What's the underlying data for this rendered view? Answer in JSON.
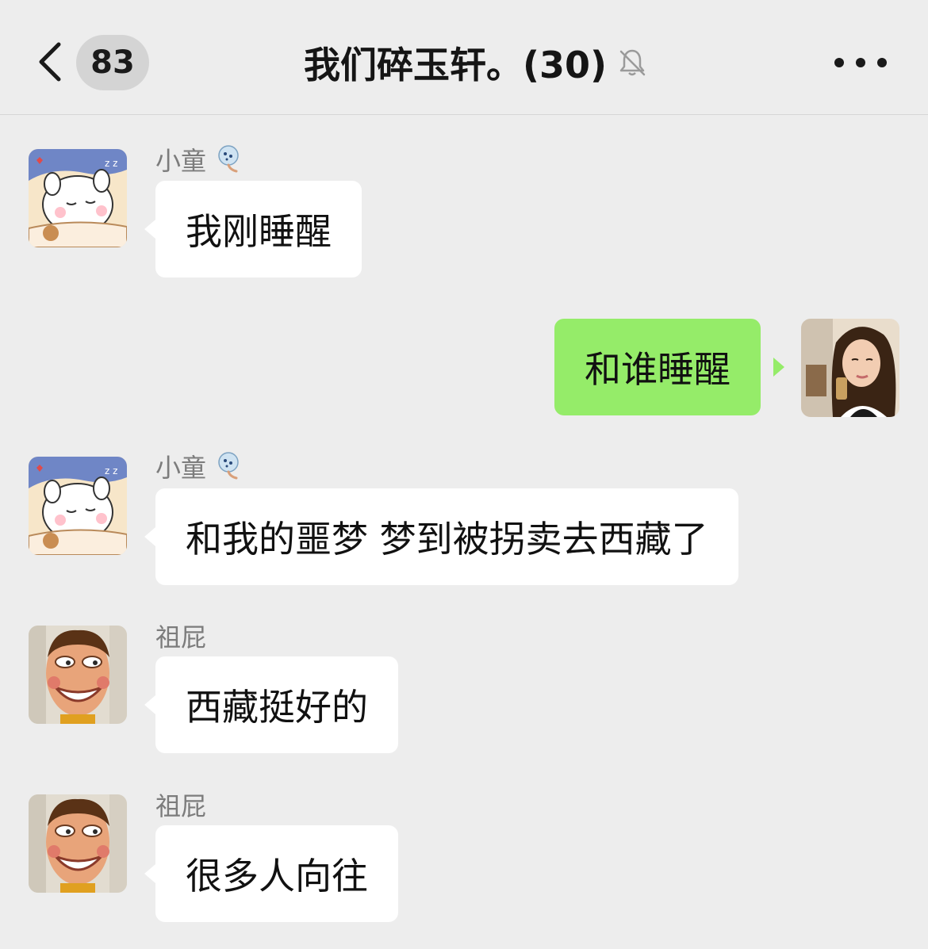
{
  "header": {
    "back_icon": "chevron-left-icon",
    "unread_count": "83",
    "title": "我们碎玉轩。(30)",
    "mute_icon": "bell-off-icon",
    "more_icon": "more-horizontal-icon"
  },
  "colors": {
    "background": "#ededed",
    "bubble_incoming": "#ffffff",
    "bubble_outgoing": "#95ec69",
    "badge": "#d4d4d4"
  },
  "messages": [
    {
      "sender": "小童",
      "badge_icon": "bear-emoji-icon",
      "direction": "incoming",
      "text": "我刚睡醒"
    },
    {
      "sender": "",
      "direction": "outgoing",
      "text": "和谁睡醒"
    },
    {
      "sender": "小童",
      "badge_icon": "bear-emoji-icon",
      "direction": "incoming",
      "text": "和我的噩梦 梦到被拐卖去西藏了"
    },
    {
      "sender": "祖屁",
      "direction": "incoming",
      "text": "西藏挺好的"
    },
    {
      "sender": "祖屁",
      "direction": "incoming",
      "text": "很多人向往"
    }
  ]
}
